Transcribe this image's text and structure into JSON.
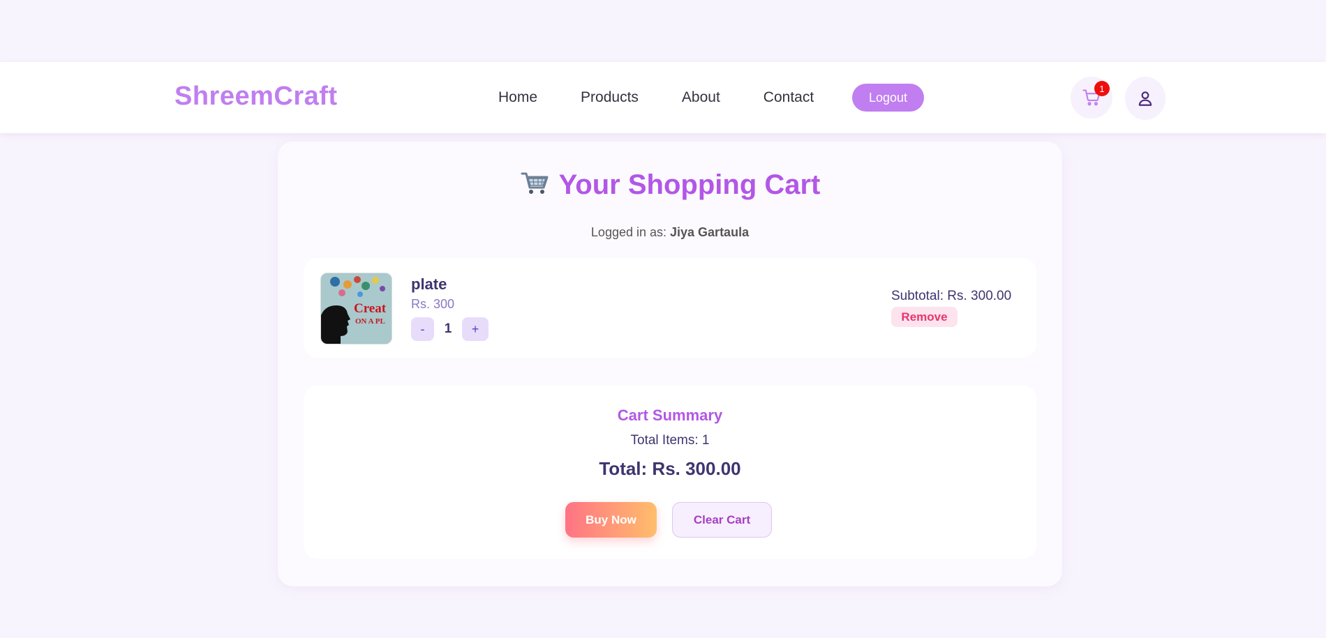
{
  "navbar": {
    "brand": "ShreemCraft",
    "links": [
      {
        "label": "Home"
      },
      {
        "label": "Products"
      },
      {
        "label": "About"
      },
      {
        "label": "Contact"
      }
    ],
    "logout_label": "Logout",
    "cart_icon": "cart-icon",
    "cart_count": "1",
    "profile_icon": "user-icon"
  },
  "cart": {
    "title_emoji": "🛒",
    "title": "Your Shopping Cart",
    "logged_in_prefix": "Logged in as: ",
    "user_name": "Jiya Gartaula",
    "items": [
      {
        "name": "plate",
        "price": "Rs. 300",
        "image_text_top": "Creat",
        "image_text_bottom": "ON A PL",
        "qty_minus": "-",
        "quantity": "1",
        "qty_plus": "+",
        "subtotal": "Subtotal: Rs. 300.00",
        "remove_label": "Remove"
      }
    ]
  },
  "summary": {
    "title": "Cart Summary",
    "total_items": "Total Items: 1",
    "total": "Total: Rs. 300.00",
    "buy_label": "Buy Now",
    "clear_label": "Clear Cart"
  },
  "colors": {
    "brand": "#c07ef0",
    "accent": "#b257e6",
    "text_dark": "#3d356f",
    "badge": "#ee0e0e",
    "remove": "#e8356d"
  }
}
